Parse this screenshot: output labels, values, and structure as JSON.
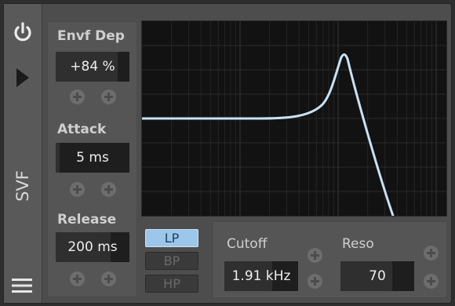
{
  "device": {
    "name": "SVF"
  },
  "params": {
    "envelope_depth": {
      "label": "Envf Dep",
      "value": "+84 %",
      "fill": 0.84
    },
    "attack": {
      "label": "Attack",
      "value": "5 ms",
      "fill": 0.05
    },
    "release": {
      "label": "Release",
      "value": "200 ms",
      "fill": 0.74
    }
  },
  "filter_modes": {
    "options": [
      "LP",
      "BP",
      "HP"
    ],
    "selected": "LP"
  },
  "cutoff": {
    "label": "Cutoff",
    "value": "1.91 kHz",
    "fill": 0.65
  },
  "resonance": {
    "label": "Reso",
    "value": "70",
    "fill": 0.7
  },
  "colors": {
    "accent": "#9cc6ea",
    "curve": "#c8e2f7",
    "graph_background": "#121212"
  },
  "icons": [
    "power-icon",
    "play-icon",
    "menu-icon",
    "add-modulator-icon"
  ]
}
